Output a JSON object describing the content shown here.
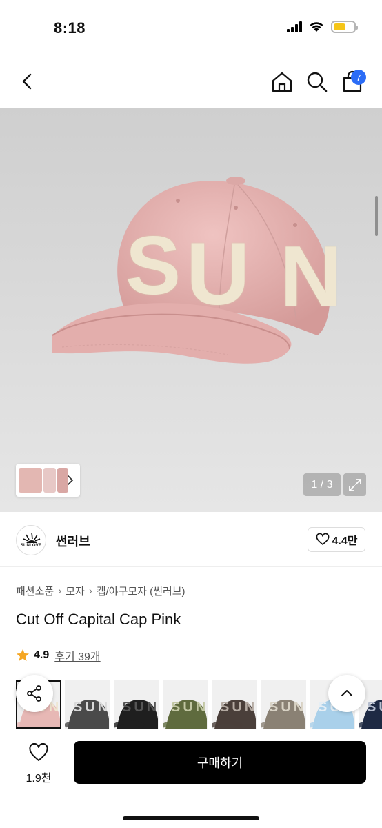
{
  "status": {
    "time": "8:18",
    "battery_color": "#f5c518"
  },
  "nav": {
    "cart_badge": "7"
  },
  "gallery": {
    "counter": "1 / 3",
    "cap_color": "#e8b4b2",
    "patch_color": "#efe6d0",
    "cap_letters": "SUN"
  },
  "brand": {
    "name": "썬러브",
    "logo_text": "SUNLOVE",
    "likes": "4.4만"
  },
  "breadcrumb": [
    "패션소품",
    "모자",
    "캡/야구모자 (썬러브)"
  ],
  "product": {
    "title": "Cut Off Capital Cap Pink",
    "rating": "4.9",
    "reviews": "후기 39개"
  },
  "swatches": [
    {
      "color": "#e7b8b5",
      "text": "#efe6d0",
      "label": "SUN"
    },
    {
      "color": "#4a4a4a",
      "text": "#d9d9d9",
      "label": "SUN"
    },
    {
      "color": "#1f1f1f",
      "text": "#555",
      "label": "SUN"
    },
    {
      "color": "#5f6b3e",
      "text": "#c2c7a3",
      "label": "SUN"
    },
    {
      "color": "#4a3f3a",
      "text": "#b4aaa2",
      "label": "SUN"
    },
    {
      "color": "#8a8174",
      "text": "#d8d2c4",
      "label": "SUN"
    },
    {
      "color": "#a9d0ea",
      "text": "#e4eef5",
      "label": "SUN"
    },
    {
      "color": "#1e2a44",
      "text": "#b4bccd",
      "label": "SUN"
    }
  ],
  "bottom": {
    "wish_count": "1.9천",
    "buy_label": "구매하기"
  }
}
